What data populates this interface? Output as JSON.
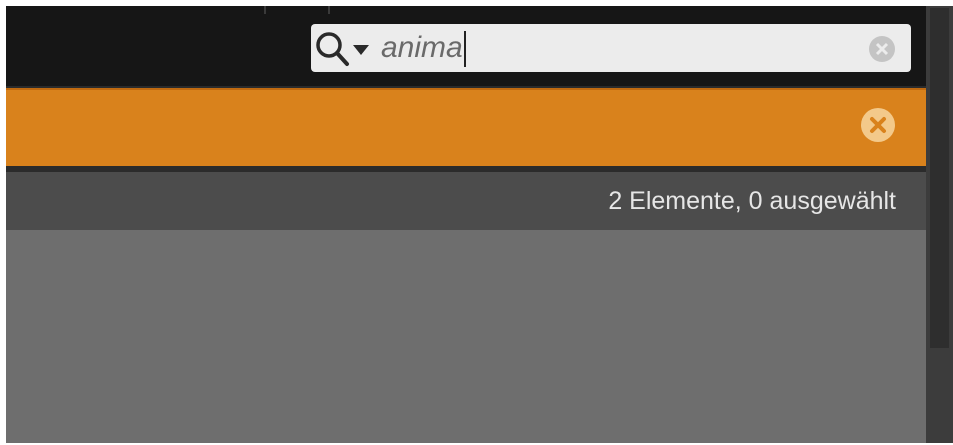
{
  "search": {
    "query": "anima",
    "icon": "search-icon",
    "dropdown_icon": "chevron-down-icon",
    "clear_icon": "clear-icon"
  },
  "filter_bar": {
    "close_icon": "close-icon",
    "accent_color": "#d9821c"
  },
  "status": {
    "text": "2 Elemente, 0 ausgewählt"
  },
  "colors": {
    "topbar": "#161616",
    "status_bar": "#4c4c4c",
    "content": "#6e6e6e"
  }
}
